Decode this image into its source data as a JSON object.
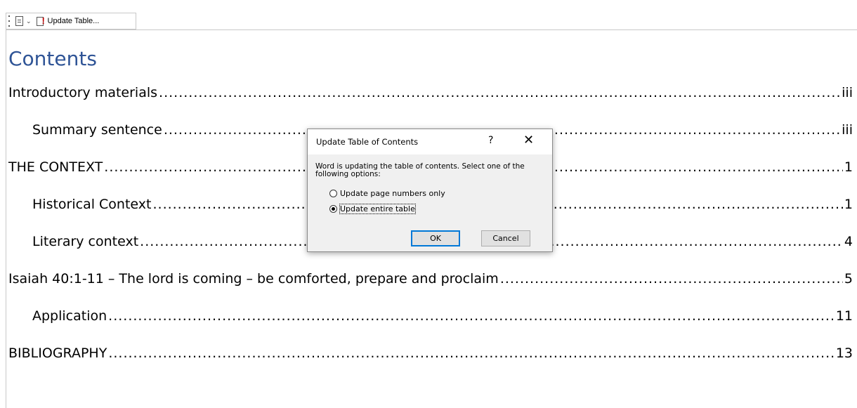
{
  "toolbar": {
    "update_label": "Update Table...",
    "icons": [
      "grip-icon",
      "document-icon",
      "chevron-down-icon",
      "update-table-icon"
    ]
  },
  "toc": {
    "heading": "Contents",
    "heading_color": "#2f5496",
    "entries": [
      {
        "text": "Introductory materials",
        "page": "iii",
        "level": 1
      },
      {
        "text": "Summary sentence",
        "page": "iii",
        "level": 2
      },
      {
        "text": "THE CONTEXT",
        "page": "1",
        "level": 1
      },
      {
        "text": "Historical Context",
        "page": "1",
        "level": 2
      },
      {
        "text": "Literary context",
        "page": "4",
        "level": 2
      },
      {
        "text": "Isaiah 40:1-11 – The lord is coming – be comforted, prepare and proclaim",
        "page": "5",
        "level": 1
      },
      {
        "text": "Application",
        "page": "11",
        "level": 2
      },
      {
        "text": "BIBLIOGRAPHY",
        "page": "13",
        "level": 1
      }
    ]
  },
  "dialog": {
    "title": "Update Table of Contents",
    "help": "?",
    "close": "✕",
    "message": "Word is updating the table of contents.  Select one of the following options:",
    "options": [
      {
        "label": "Update page numbers only",
        "selected": false
      },
      {
        "label": "Update entire table",
        "selected": true
      }
    ],
    "ok_label": "OK",
    "cancel_label": "Cancel",
    "accent_color": "#0078d7"
  }
}
